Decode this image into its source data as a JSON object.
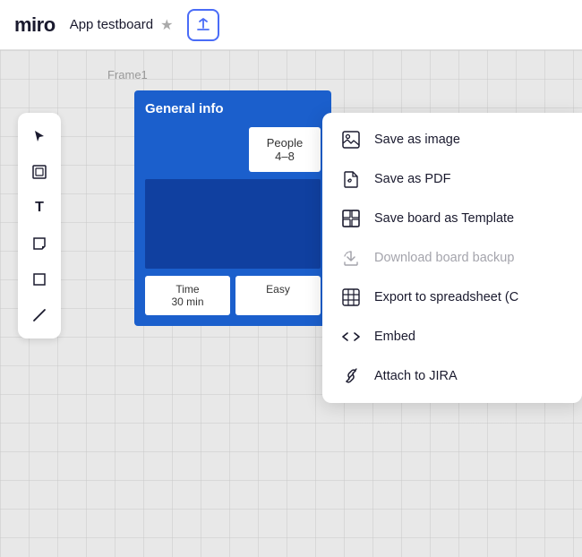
{
  "topbar": {
    "logo": "miro",
    "board_title": "App testboard",
    "star_icon": "★",
    "upload_icon": "⬆"
  },
  "canvas": {
    "frame_label": "Frame1",
    "board_content": {
      "title": "General info",
      "sticky_people_line1": "People",
      "sticky_people_line2": "4–8",
      "sticky_time_line1": "Time",
      "sticky_time_line2": "30 min",
      "sticky_easy": "Easy"
    }
  },
  "toolbar": {
    "tools": [
      {
        "name": "cursor",
        "icon": "▲",
        "label": "cursor-tool"
      },
      {
        "name": "frame",
        "icon": "⬜",
        "label": "frame-tool"
      },
      {
        "name": "text",
        "icon": "T",
        "label": "text-tool"
      },
      {
        "name": "sticky",
        "icon": "◱",
        "label": "sticky-tool"
      },
      {
        "name": "shape",
        "icon": "□",
        "label": "shape-tool"
      },
      {
        "name": "line",
        "icon": "╱",
        "label": "line-tool"
      }
    ]
  },
  "dropdown": {
    "items": [
      {
        "id": "save-image",
        "icon": "image",
        "label": "Save as image",
        "disabled": false
      },
      {
        "id": "save-pdf",
        "icon": "pdf",
        "label": "Save as PDF",
        "disabled": false
      },
      {
        "id": "save-template",
        "icon": "template",
        "label": "Save board as Template",
        "disabled": false
      },
      {
        "id": "download-backup",
        "icon": "backup",
        "label": "Download board backup",
        "disabled": true
      },
      {
        "id": "export-spreadsheet",
        "icon": "spreadsheet",
        "label": "Export to spreadsheet (C",
        "disabled": false
      },
      {
        "id": "embed",
        "icon": "embed",
        "label": "Embed",
        "disabled": false
      },
      {
        "id": "attach-jira",
        "icon": "jira",
        "label": "Attach to JIRA",
        "disabled": false
      }
    ]
  }
}
